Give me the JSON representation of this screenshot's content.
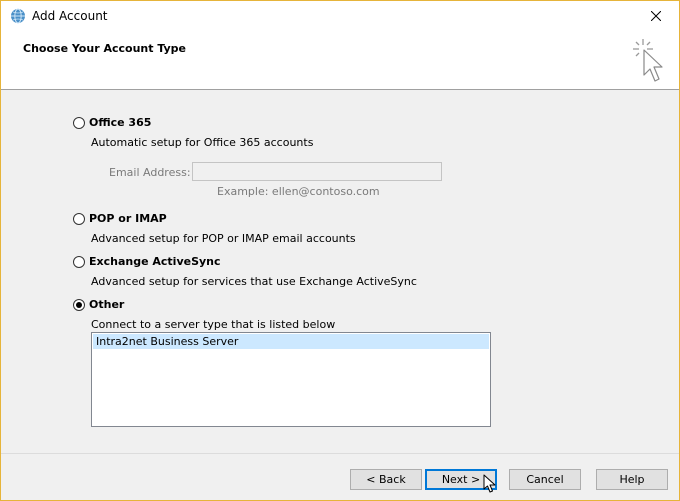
{
  "window": {
    "title": "Add Account"
  },
  "header": {
    "heading": "Choose Your Account Type"
  },
  "options": [
    {
      "label": "Office 365",
      "description": "Automatic setup for Office 365 accounts",
      "selected": false
    },
    {
      "label": "POP or IMAP",
      "description": "Advanced setup for POP or IMAP email accounts",
      "selected": false
    },
    {
      "label": "Exchange ActiveSync",
      "description": "Advanced setup for services that use Exchange ActiveSync",
      "selected": false
    },
    {
      "label": "Other",
      "description": "Connect to a server type that is listed below",
      "selected": true
    }
  ],
  "email": {
    "label": "Email Address:",
    "value": "",
    "example": "Example: ellen@contoso.com"
  },
  "server_list": {
    "items": [
      "Intra2net Business Server"
    ],
    "selected_index": 0
  },
  "buttons": {
    "back": "< Back",
    "next": "Next >",
    "cancel": "Cancel",
    "help": "Help"
  },
  "icons": {
    "app": "outlook-globe-icon",
    "wizard": "sparkle-cursor-icon",
    "close": "close-icon"
  }
}
